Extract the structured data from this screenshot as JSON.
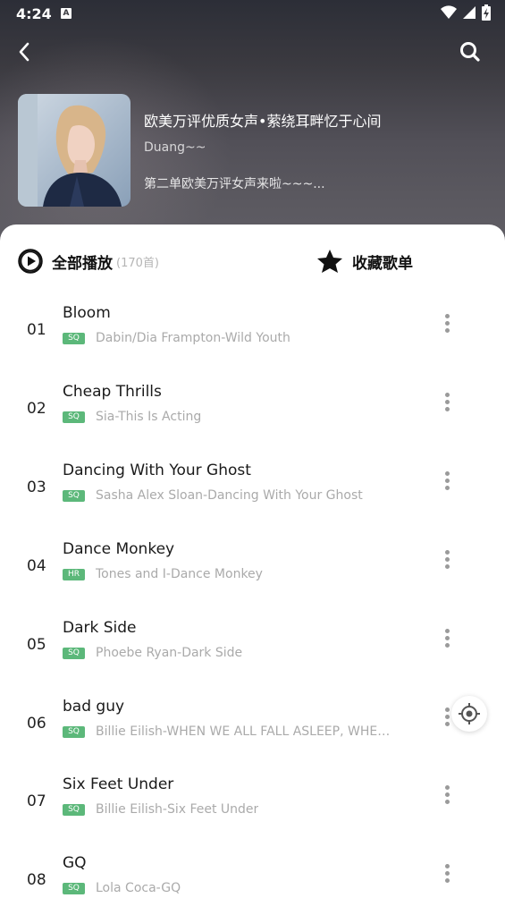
{
  "status_bar": {
    "time": "4:24",
    "notification_icon": "A",
    "icons": [
      "wifi-icon",
      "signal-icon",
      "battery-charging-icon"
    ]
  },
  "nav": {
    "back_icon": "chevron-left-icon",
    "search_icon": "search-icon"
  },
  "playlist": {
    "title": "欧美万评优质女声•萦绕耳畔忆于心间",
    "author": "Duang~~",
    "description": "第二单欧美万评女声来啦~~~..."
  },
  "actions": {
    "play_all_label": "全部播放",
    "play_all_count": "(170首)",
    "collect_label": "收藏歌单"
  },
  "colors": {
    "badge": "#5cb87a",
    "header_bg": "#4a4850"
  },
  "songs": [
    {
      "num": "01",
      "title": "Bloom",
      "badge": "SQ",
      "artist": "Dabin/Dia Frampton-Wild Youth"
    },
    {
      "num": "02",
      "title": "Cheap Thrills",
      "badge": "SQ",
      "artist": "Sia-This Is Acting"
    },
    {
      "num": "03",
      "title": "Dancing With Your Ghost",
      "badge": "SQ",
      "artist": "Sasha Alex Sloan-Dancing With Your Ghost"
    },
    {
      "num": "04",
      "title": "Dance Monkey",
      "badge": "HR",
      "artist": "Tones and I-Dance Monkey"
    },
    {
      "num": "05",
      "title": "Dark Side",
      "badge": "SQ",
      "artist": "Phoebe Ryan-Dark Side"
    },
    {
      "num": "06",
      "title": "bad guy",
      "badge": "SQ",
      "artist": "Billie Eilish-WHEN WE ALL FALL ASLEEP, WHER..."
    },
    {
      "num": "07",
      "title": "Six Feet Under",
      "badge": "SQ",
      "artist": "Billie Eilish-Six Feet Under"
    },
    {
      "num": "08",
      "title": "GQ",
      "badge": "SQ",
      "artist": "Lola Coca-GQ"
    }
  ]
}
